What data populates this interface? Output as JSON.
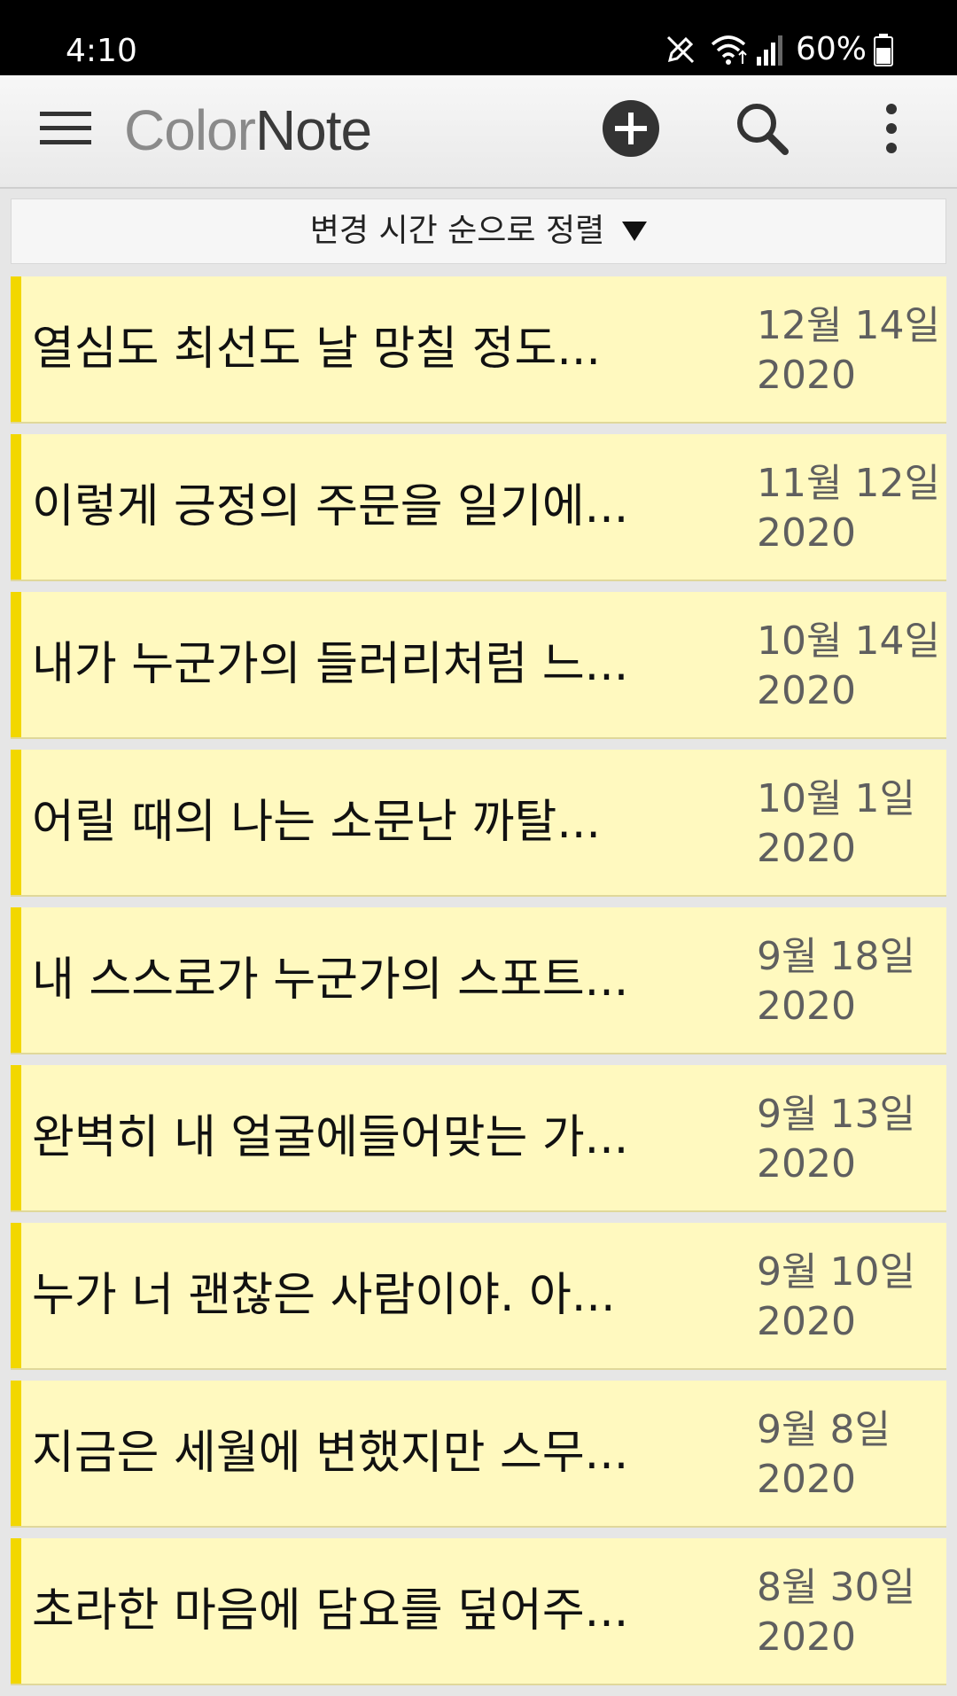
{
  "status_bar": {
    "time": "4:10",
    "battery": "60%",
    "icons": [
      "pen-icon",
      "wifi-icon",
      "signal-icon",
      "battery-icon"
    ]
  },
  "app_bar": {
    "logo_part1": "Color",
    "logo_part2": "Note",
    "icons": [
      "hamburger-menu-icon",
      "add-circle-icon",
      "search-icon",
      "more-vertical-icon"
    ]
  },
  "sort": {
    "label": "변경 시간 순으로 정렬"
  },
  "colors": {
    "note_background": "#fff9bf",
    "note_stripe": "#f2d700",
    "status_bar": "#000000"
  },
  "notes": [
    {
      "title": "열심도 최선도 날 망칠 정도...",
      "date_line1": "12월 14일",
      "date_line2": "2020"
    },
    {
      "title": "이렇게 긍정의 주문을 일기에...",
      "date_line1": "11월 12일",
      "date_line2": "2020"
    },
    {
      "title": "내가 누군가의 들러리처럼 느...",
      "date_line1": "10월 14일",
      "date_line2": "2020"
    },
    {
      "title": "어릴 때의 나는 소문난 까탈...",
      "date_line1": "10월 1일",
      "date_line2": "2020"
    },
    {
      "title": "내 스스로가 누군가의 스포트...",
      "date_line1": "9월 18일",
      "date_line2": "2020"
    },
    {
      "title": "완벽히 내 얼굴에들어맞는 가...",
      "date_line1": "9월 13일",
      "date_line2": "2020"
    },
    {
      "title": "누가 너 괜찮은 사람이야. 아...",
      "date_line1": "9월 10일",
      "date_line2": "2020"
    },
    {
      "title": "지금은 세월에 변했지만 스무...",
      "date_line1": "9월 8일",
      "date_line2": "2020"
    },
    {
      "title": "초라한 마음에 담요를 덮어주...",
      "date_line1": "8월 30일",
      "date_line2": "2020"
    }
  ]
}
